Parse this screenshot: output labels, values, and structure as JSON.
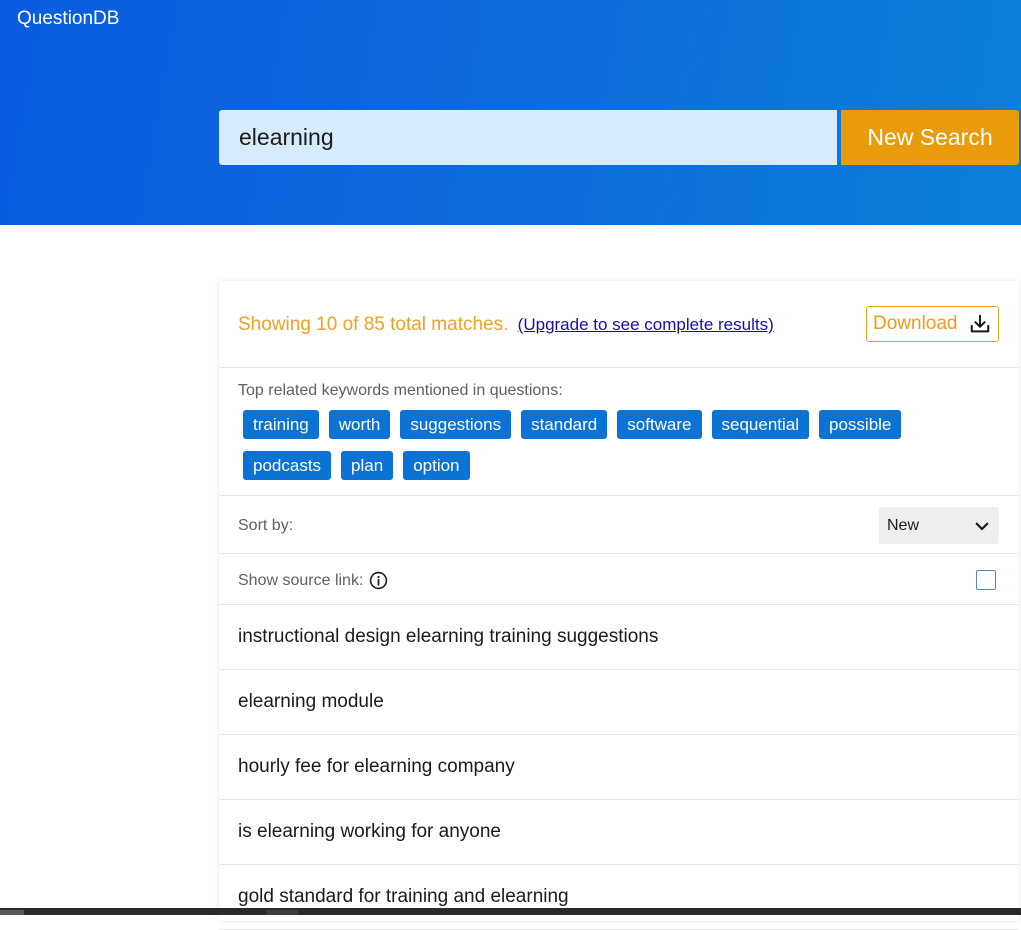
{
  "app": {
    "brand": "QuestionDB"
  },
  "search": {
    "value": "elearning",
    "button_label": "New Search"
  },
  "summary": {
    "text": "Showing 10 of 85 total matches.",
    "upgrade_link": "(Upgrade to see complete results)",
    "download_label": "Download",
    "download_icon": "download-icon"
  },
  "keywords": {
    "title": "Top related keywords mentioned in questions:",
    "items": [
      "training",
      "worth",
      "suggestions",
      "standard",
      "software",
      "sequential",
      "possible",
      "podcasts",
      "plan",
      "option"
    ]
  },
  "sort": {
    "label": "Sort by:",
    "selected": "New",
    "icon": "chevron-down-icon"
  },
  "source": {
    "label": "Show source link:",
    "icon": "info-icon",
    "checked": false
  },
  "results": [
    "instructional design elearning training suggestions",
    "elearning module",
    "hourly fee for elearning company",
    "is elearning working for anyone",
    "gold standard for training and elearning"
  ],
  "colors": {
    "header_start": "#0a5ce0",
    "header_end": "#0d7fd8",
    "accent_orange": "#e99b0b",
    "tag_blue": "#0b73d4",
    "link_blue": "#1a0dab"
  }
}
